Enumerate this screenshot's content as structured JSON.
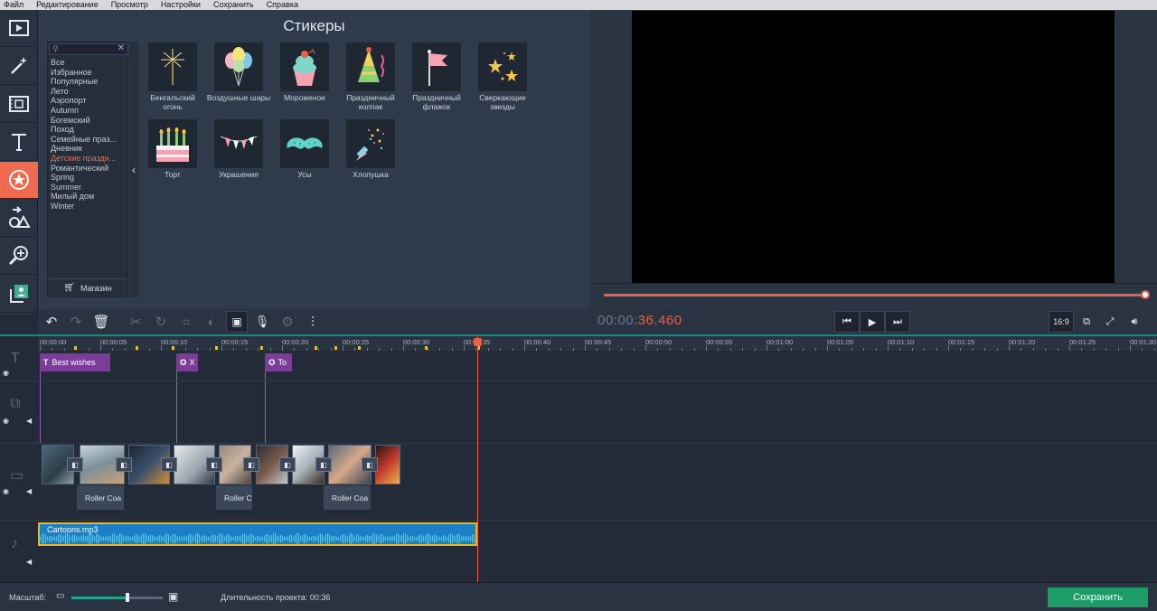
{
  "menu": [
    "Файл",
    "Редактирование",
    "Просмотр",
    "Настройки",
    "Сохранить",
    "Справка"
  ],
  "tools": [
    {
      "name": "import-tool",
      "icon": "film-import-icon"
    },
    {
      "name": "filters-tool",
      "icon": "magic-wand-icon"
    },
    {
      "name": "transitions-tool",
      "icon": "transition-icon"
    },
    {
      "name": "titles-tool",
      "icon": "text-icon"
    },
    {
      "name": "stickers-tool",
      "icon": "sticker-star-icon",
      "active": true
    },
    {
      "name": "shapes-tool",
      "icon": "shapes-icon"
    },
    {
      "name": "zoom-tool",
      "icon": "zoom-icon"
    },
    {
      "name": "more-tools",
      "icon": "person-icon"
    }
  ],
  "panel": {
    "title": "Стикеры",
    "categories": [
      "Все",
      "Избранное",
      "Популярные",
      "Лето",
      "Аэропорт",
      "Autumn",
      "Богемский",
      "Поход",
      "Семейные праз...",
      "Дневник",
      "Детские праздн...",
      "Романтический",
      "Spring",
      "Summer",
      "Милый дом",
      "Winter"
    ],
    "selected_category": "Детские праздн...",
    "store_label": "Магазин",
    "stickers": [
      {
        "label": "Бенгальский огонь",
        "icon": "sparkler-icon"
      },
      {
        "label": "Воздушные шары",
        "icon": "balloons-icon"
      },
      {
        "label": "Мороженое",
        "icon": "ice-cream-icon"
      },
      {
        "label": "Праздничный колпак",
        "icon": "party-hat-icon"
      },
      {
        "label": "Праздничный флажок",
        "icon": "flag-icon"
      },
      {
        "label": "Сверкающие звезды",
        "icon": "stars-icon"
      },
      {
        "label": "Торт",
        "icon": "cake-icon"
      },
      {
        "label": "Украшения",
        "icon": "garland-icon"
      },
      {
        "label": "Усы",
        "icon": "mustache-icon"
      },
      {
        "label": "Хлопушка",
        "icon": "popper-icon"
      }
    ]
  },
  "player": {
    "timecode_dim": "00:00:",
    "timecode_hot": "36.460",
    "progress": 1.0,
    "aspect": "16:9"
  },
  "ruler_labels": [
    "00:00:00",
    "00:00:05",
    "00:00:10",
    "00:00:15",
    "00:00:20",
    "00:00:25",
    "00:00:30",
    "00:00:35",
    "00:00:40",
    "00:00:45",
    "00:00:50",
    "00:00:55",
    "00:01:00",
    "00:01:05",
    "00:01:10",
    "00:01:15",
    "00:01:20",
    "00:01:25",
    "00:01:30"
  ],
  "timeline": {
    "title_clips": [
      "Best wishes",
      "X",
      "To"
    ],
    "video_labels": [
      "Roller Coa",
      "Roller C",
      "Roller Coa"
    ],
    "audio_clip": "Cartoons.mp3",
    "playhead_time": "00:00:35"
  },
  "bottom": {
    "scale_label": "Масштаб:",
    "zoom_level": 0.6,
    "duration_label": "Длительность проекта:",
    "duration_value": "00:36",
    "save_label": "Сохранить"
  },
  "colors": {
    "accent": "#f06a4f",
    "save": "#1d9c68",
    "title_clip": "#7a3e98",
    "audio": "#1a7fc4"
  }
}
